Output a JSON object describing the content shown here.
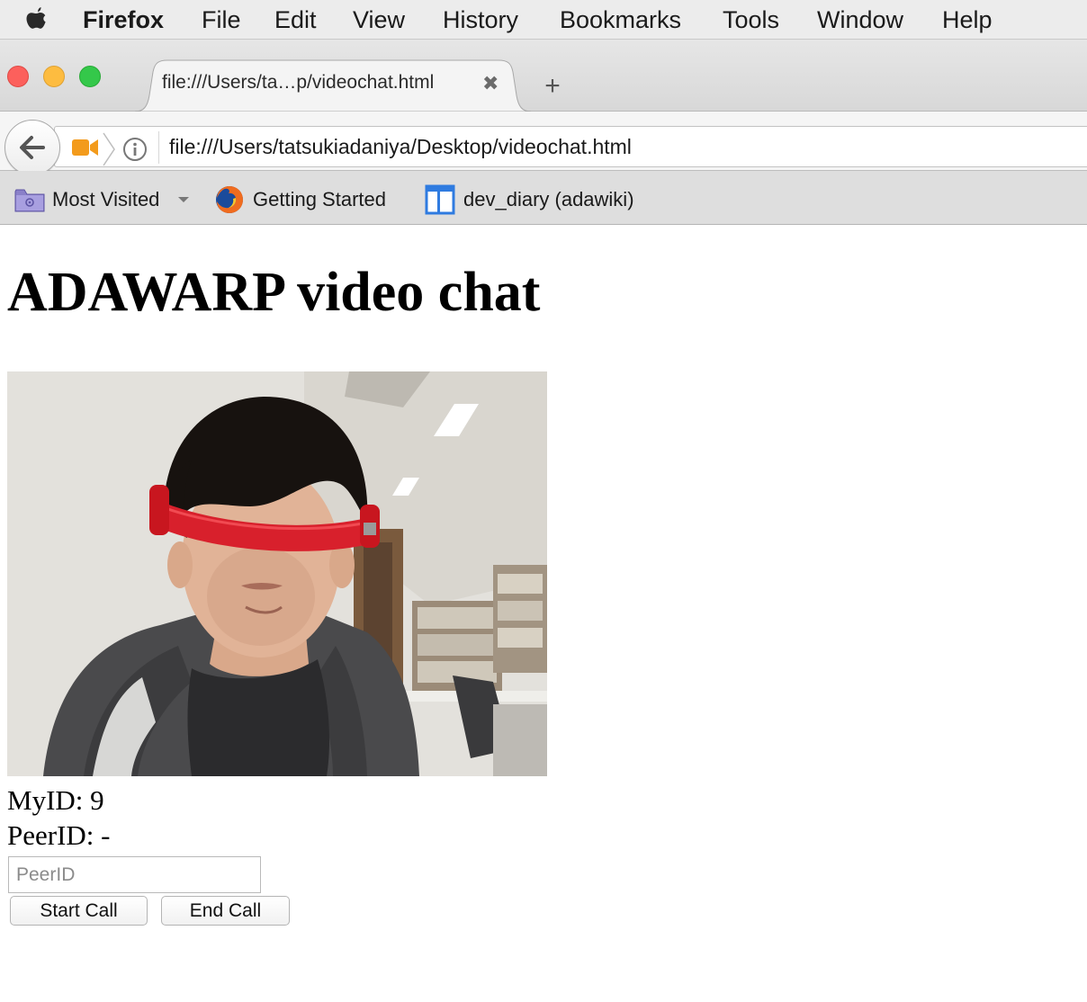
{
  "menubar": {
    "app_name": "Firefox",
    "items": [
      "File",
      "Edit",
      "View",
      "History",
      "Bookmarks",
      "Tools",
      "Window",
      "Help"
    ]
  },
  "tab": {
    "title": "file:///Users/ta…p/videochat.html",
    "close_glyph": "✖",
    "new_tab_glyph": "+"
  },
  "navbar": {
    "url": "file:///Users/tatsukiadaniya/Desktop/videochat.html",
    "icons": [
      "back-arrow-icon",
      "camera-icon",
      "info-icon"
    ]
  },
  "bookmarks": {
    "items": [
      {
        "label": "Most Visited",
        "icon": "folder-icon",
        "has_dropdown": true
      },
      {
        "label": "Getting Started",
        "icon": "firefox-icon"
      },
      {
        "label": "dev_diary (adawiki)",
        "icon": "layout-icon"
      }
    ]
  },
  "page": {
    "title": "ADAWARP video chat",
    "my_id_text": "MyID: 9",
    "peer_id_text": "PeerID: -",
    "peer_input": {
      "placeholder": "PeerID",
      "value": ""
    },
    "start_call_label": "Start Call",
    "end_call_label": "End Call"
  },
  "colors": {
    "close": "#fc605c",
    "minimize": "#fdbc40",
    "zoom": "#34c84a",
    "camera_icon": "#f39b1c",
    "headphones": "#d8202c"
  }
}
